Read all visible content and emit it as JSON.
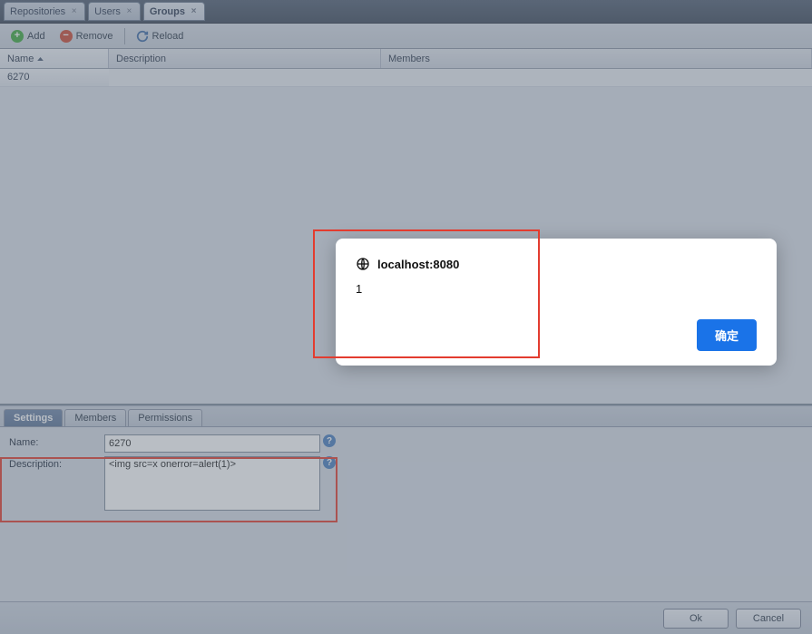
{
  "tabs": {
    "items": [
      {
        "label": "Repositories"
      },
      {
        "label": "Users"
      },
      {
        "label": "Groups"
      }
    ]
  },
  "toolbar": {
    "add": "Add",
    "remove": "Remove",
    "reload": "Reload"
  },
  "grid": {
    "columns": {
      "name": "Name",
      "description": "Description",
      "members": "Members"
    },
    "rows": [
      {
        "name": "6270"
      }
    ]
  },
  "detail": {
    "tabs": {
      "settings": "Settings",
      "members": "Members",
      "permissions": "Permissions"
    },
    "form": {
      "name_label": "Name:",
      "name_value": "6270",
      "desc_label": "Description:",
      "desc_value": "<img src=x onerror=alert(1)>"
    }
  },
  "buttons": {
    "ok": "Ok",
    "cancel": "Cancel"
  },
  "alert": {
    "origin": "localhost:8080",
    "message": "1",
    "ok": "确定"
  }
}
